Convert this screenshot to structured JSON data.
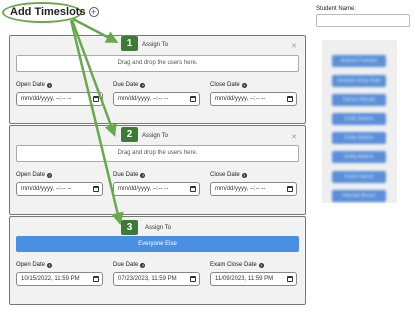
{
  "header": {
    "title": "Add Timeslots",
    "add_icon": "plus-circle-icon"
  },
  "timeslots": [
    {
      "badge": "1",
      "assign_label": "Assign To",
      "drop_text": "Drag and drop the users here.",
      "close_icon": "close-icon",
      "fields": [
        {
          "label": "Open Date",
          "value": "mm/dd/yyyy, --:-- --"
        },
        {
          "label": "Due Date",
          "value": "mm/dd/yyyy, --:-- --"
        },
        {
          "label": "Close Date",
          "value": "mm/dd/yyyy, --:-- --"
        }
      ]
    },
    {
      "badge": "2",
      "assign_label": "Assign To",
      "drop_text": "Drag and drop the users here.",
      "close_icon": "close-icon",
      "fields": [
        {
          "label": "Open Date",
          "value": "mm/dd/yyyy, --:-- --"
        },
        {
          "label": "Due Date",
          "value": "mm/dd/yyyy, --:-- --"
        },
        {
          "label": "Close Date",
          "value": "mm/dd/yyyy, --:-- --"
        }
      ]
    },
    {
      "badge": "3",
      "assign_label": "Assign To",
      "everyone_label": "Everyone Else",
      "fields": [
        {
          "label": "Open Date",
          "value": "10/15/2022, 11:59 PM"
        },
        {
          "label": "Due Date",
          "value": "07/23/2023, 11:59 PM"
        },
        {
          "label": "Exam Close Date",
          "value": "11/09/2023, 11:59 PM"
        }
      ]
    }
  ],
  "students": {
    "label": "Student Name:",
    "search_value": "",
    "chips": [
      "Antonio Fuentes",
      "Brandon King-Todd",
      "Darren Woods",
      "Emily Adams",
      "Emily Adams",
      "Emily Adams",
      "Frank Garcia",
      "Hannah Brown"
    ]
  },
  "colors": {
    "badge": "#3d7a35",
    "arrow": "#6aa84f",
    "everyone_button": "#4a90e2",
    "student_chip": "#5b8fd9",
    "panel_bg": "#f2f2f2"
  }
}
